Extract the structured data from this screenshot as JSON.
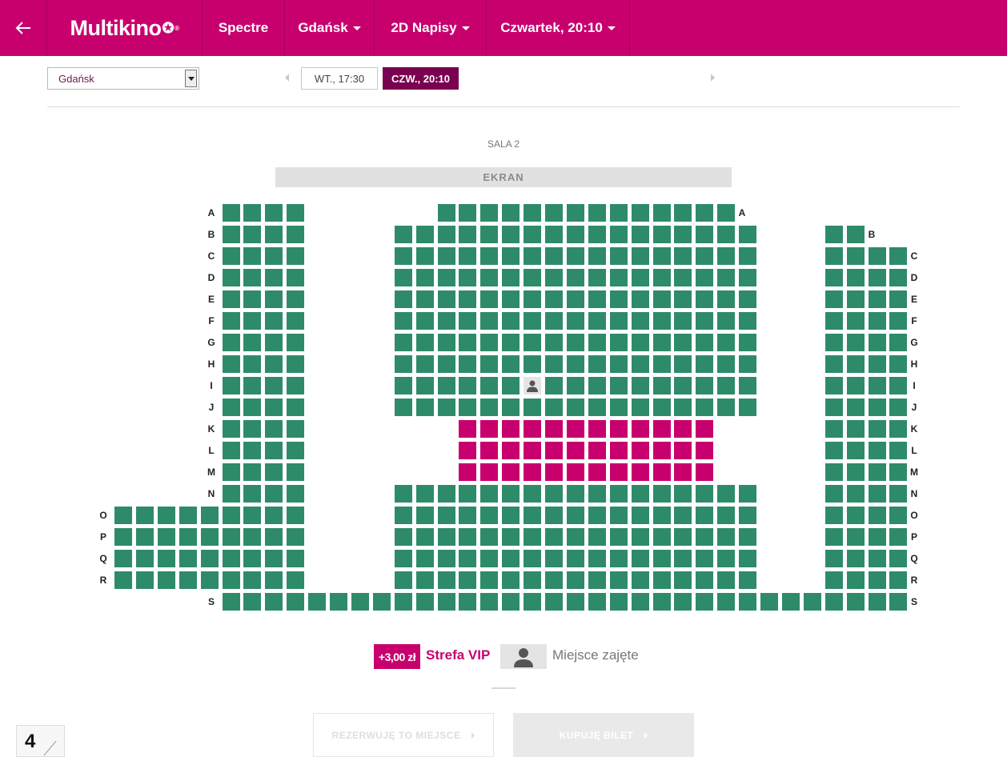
{
  "header": {
    "logo": "Multikino",
    "movie": "Spectre",
    "city": "Gdańsk",
    "format": "2D Napisy",
    "showtime": "Czwartek, 20:10"
  },
  "filters": {
    "city_select": "Gdańsk",
    "times": [
      {
        "label": "WT., 17:30",
        "selected": false
      },
      {
        "label": "CZW., 20:10",
        "selected": true
      }
    ]
  },
  "hall": {
    "name": "SALA 2",
    "screen": "EKRAN",
    "rows": [
      {
        "label": "A",
        "left": true,
        "right": false,
        "segments": [
          [
            5,
            8,
            "free"
          ],
          [
            15,
            28,
            "free"
          ]
        ]
      },
      {
        "label": "B",
        "left": true,
        "right": true,
        "segments": [
          [
            5,
            8,
            "free"
          ],
          [
            13,
            29,
            "free"
          ],
          [
            33,
            34,
            "free"
          ]
        ]
      },
      {
        "label": "C",
        "left": true,
        "right": true,
        "segments": [
          [
            5,
            8,
            "free"
          ],
          [
            13,
            29,
            "free"
          ],
          [
            33,
            36,
            "free"
          ]
        ]
      },
      {
        "label": "D",
        "left": true,
        "right": true,
        "segments": [
          [
            5,
            8,
            "free"
          ],
          [
            13,
            29,
            "free"
          ],
          [
            33,
            36,
            "free"
          ]
        ]
      },
      {
        "label": "E",
        "left": true,
        "right": true,
        "segments": [
          [
            5,
            8,
            "free"
          ],
          [
            13,
            29,
            "free"
          ],
          [
            33,
            36,
            "free"
          ]
        ]
      },
      {
        "label": "F",
        "left": true,
        "right": true,
        "segments": [
          [
            5,
            8,
            "free"
          ],
          [
            13,
            29,
            "free"
          ],
          [
            33,
            36,
            "free"
          ]
        ]
      },
      {
        "label": "G",
        "left": true,
        "right": true,
        "segments": [
          [
            5,
            8,
            "free"
          ],
          [
            13,
            29,
            "free"
          ],
          [
            33,
            36,
            "free"
          ]
        ]
      },
      {
        "label": "H",
        "left": true,
        "right": true,
        "segments": [
          [
            5,
            8,
            "free"
          ],
          [
            13,
            29,
            "free"
          ],
          [
            33,
            36,
            "free"
          ]
        ]
      },
      {
        "label": "I",
        "left": true,
        "right": true,
        "segments": [
          [
            5,
            8,
            "free"
          ],
          [
            13,
            18,
            "free"
          ],
          [
            19,
            19,
            "taken"
          ],
          [
            20,
            29,
            "free"
          ],
          [
            33,
            36,
            "free"
          ]
        ]
      },
      {
        "label": "J",
        "left": true,
        "right": true,
        "segments": [
          [
            5,
            8,
            "free"
          ],
          [
            13,
            29,
            "free"
          ],
          [
            33,
            36,
            "free"
          ]
        ]
      },
      {
        "label": "K",
        "left": true,
        "right": true,
        "segments": [
          [
            5,
            8,
            "free"
          ],
          [
            16,
            27,
            "vip"
          ],
          [
            33,
            36,
            "free"
          ]
        ]
      },
      {
        "label": "L",
        "left": true,
        "right": true,
        "segments": [
          [
            5,
            8,
            "free"
          ],
          [
            16,
            27,
            "vip"
          ],
          [
            33,
            36,
            "free"
          ]
        ]
      },
      {
        "label": "M",
        "left": true,
        "right": true,
        "segments": [
          [
            5,
            8,
            "free"
          ],
          [
            16,
            27,
            "vip"
          ],
          [
            33,
            36,
            "free"
          ]
        ]
      },
      {
        "label": "N",
        "left": true,
        "right": true,
        "segments": [
          [
            5,
            8,
            "free"
          ],
          [
            13,
            29,
            "free"
          ],
          [
            33,
            36,
            "free"
          ]
        ]
      },
      {
        "label": "O",
        "left": true,
        "right": true,
        "segments": [
          [
            0,
            8,
            "free"
          ],
          [
            13,
            29,
            "free"
          ],
          [
            33,
            36,
            "free"
          ]
        ]
      },
      {
        "label": "P",
        "left": true,
        "right": true,
        "segments": [
          [
            0,
            8,
            "free"
          ],
          [
            13,
            29,
            "free"
          ],
          [
            33,
            36,
            "free"
          ]
        ]
      },
      {
        "label": "Q",
        "left": true,
        "right": true,
        "segments": [
          [
            0,
            8,
            "free"
          ],
          [
            13,
            29,
            "free"
          ],
          [
            33,
            36,
            "free"
          ]
        ]
      },
      {
        "label": "R",
        "left": true,
        "right": true,
        "segments": [
          [
            0,
            8,
            "free"
          ],
          [
            13,
            29,
            "free"
          ],
          [
            33,
            36,
            "free"
          ]
        ]
      },
      {
        "label": "S",
        "left": true,
        "right": true,
        "segments": [
          [
            5,
            36,
            "free"
          ]
        ]
      }
    ]
  },
  "legend": {
    "vip_price": "+3,00 zł",
    "vip_label": "Strefa VIP",
    "taken_label": "Miejsce zajęte"
  },
  "actions": {
    "reserve": "REZERWUJĘ TO MIEJSCE",
    "buy": "KUPUJĘ BILET"
  },
  "corner_badge": "4",
  "colors": {
    "brand": "#c8006e",
    "seat_free": "#2e8b6a",
    "seat_vip": "#c8006e",
    "seat_taken": "#e4e4e4"
  }
}
